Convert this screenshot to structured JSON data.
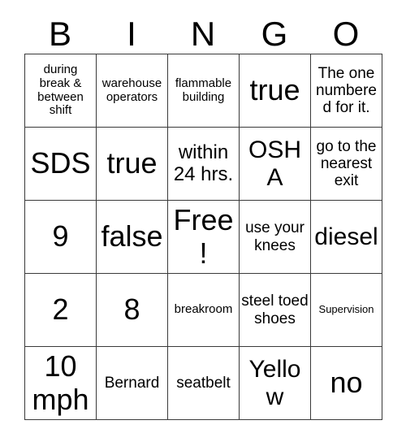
{
  "card": {
    "header_letters": [
      "B",
      "I",
      "N",
      "G",
      "O"
    ],
    "free_space_label": "Free!",
    "grid_rows": [
      [
        {
          "text": "during break & between shift",
          "size": "sm"
        },
        {
          "text": "warehouse operators",
          "size": "sm"
        },
        {
          "text": "flammable building",
          "size": "sm"
        },
        {
          "text": "true",
          "size": "xxl"
        },
        {
          "text": "The one numbered for it.",
          "size": "md"
        }
      ],
      [
        {
          "text": "SDS",
          "size": "xxl"
        },
        {
          "text": "true",
          "size": "xxl"
        },
        {
          "text": "within 24 hrs.",
          "size": "lg"
        },
        {
          "text": "OSHA",
          "size": "xl"
        },
        {
          "text": "go to the nearest exit",
          "size": "md"
        }
      ],
      [
        {
          "text": "9",
          "size": "xxl"
        },
        {
          "text": "false",
          "size": "xxl"
        },
        {
          "text": "Free!",
          "size": "xxl"
        },
        {
          "text": "use your knees",
          "size": "md"
        },
        {
          "text": "diesel",
          "size": "xl"
        }
      ],
      [
        {
          "text": "2",
          "size": "xxl"
        },
        {
          "text": "8",
          "size": "xxl"
        },
        {
          "text": "breakroom",
          "size": "sm"
        },
        {
          "text": "steel toed shoes",
          "size": "md"
        },
        {
          "text": "Supervision",
          "size": "xs"
        }
      ],
      [
        {
          "text": "10 mph",
          "size": "xxl"
        },
        {
          "text": "Bernard",
          "size": "md"
        },
        {
          "text": "seatbelt",
          "size": "md"
        },
        {
          "text": "Yellow",
          "size": "xl"
        },
        {
          "text": "no",
          "size": "xxl"
        }
      ]
    ],
    "colors": {
      "background": "#ffffff",
      "text": "#000000",
      "grid_line": "#3a3a3a"
    }
  }
}
